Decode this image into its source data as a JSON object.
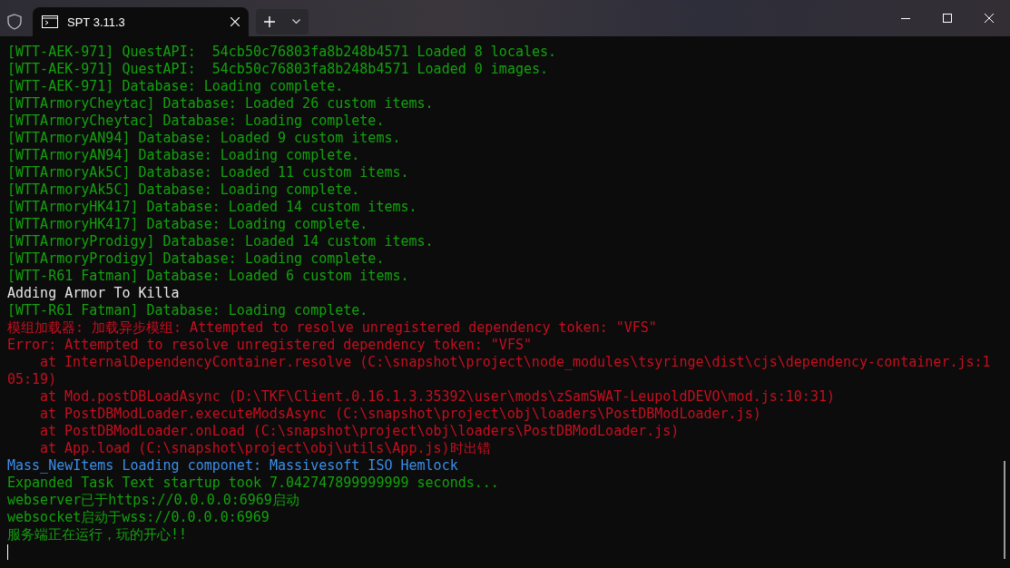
{
  "window": {
    "tab_title": "SPT 3.11.3"
  },
  "terminal": {
    "lines": [
      {
        "text": "[WTT-AEK-971] QuestAPI:  54cb50c76803fa8b248b4571 Loaded 8 locales.",
        "color": "#13a10e",
        "indented": false
      },
      {
        "text": "[WTT-AEK-971] QuestAPI:  54cb50c76803fa8b248b4571 Loaded 0 images.",
        "color": "#13a10e",
        "indented": false
      },
      {
        "text": "[WTT-AEK-971] Database: Loading complete.",
        "color": "#13a10e",
        "indented": false
      },
      {
        "text": "[WTTArmoryCheytac] Database: Loaded 26 custom items.",
        "color": "#13a10e",
        "indented": false
      },
      {
        "text": "[WTTArmoryCheytac] Database: Loading complete.",
        "color": "#13a10e",
        "indented": false
      },
      {
        "text": "[WTTArmoryAN94] Database: Loaded 9 custom items.",
        "color": "#13a10e",
        "indented": false
      },
      {
        "text": "[WTTArmoryAN94] Database: Loading complete.",
        "color": "#13a10e",
        "indented": false
      },
      {
        "text": "[WTTArmoryAk5C] Database: Loaded 11 custom items.",
        "color": "#13a10e",
        "indented": false
      },
      {
        "text": "[WTTArmoryAk5C] Database: Loading complete.",
        "color": "#13a10e",
        "indented": false
      },
      {
        "text": "[WTTArmoryHK417] Database: Loaded 14 custom items.",
        "color": "#13a10e",
        "indented": false
      },
      {
        "text": "[WTTArmoryHK417] Database: Loading complete.",
        "color": "#13a10e",
        "indented": false
      },
      {
        "text": "[WTTArmoryProdigy] Database: Loaded 14 custom items.",
        "color": "#13a10e",
        "indented": false
      },
      {
        "text": "[WTTArmoryProdigy] Database: Loading complete.",
        "color": "#13a10e",
        "indented": false
      },
      {
        "text": "[WTT-R61 Fatman] Database: Loaded 6 custom items.",
        "color": "#13a10e",
        "indented": false
      },
      {
        "text": "Adding Armor To Killa",
        "color": "#e6e6e6",
        "indented": false
      },
      {
        "text": "[WTT-R61 Fatman] Database: Loading complete.",
        "color": "#13a10e",
        "indented": false
      },
      {
        "text": "模组加载器: 加载异步模组: Attempted to resolve unregistered dependency token: \"VFS\"",
        "color": "#c50f1f",
        "indented": false
      },
      {
        "text": "Error: Attempted to resolve unregistered dependency token: \"VFS\"",
        "color": "#c50f1f",
        "indented": false
      },
      {
        "text": "at InternalDependencyContainer.resolve (C:\\snapshot\\project\\node_modules\\tsyringe\\dist\\cjs\\dependency-container.js:1",
        "color": "#c50f1f",
        "indented": true
      },
      {
        "text": "05:19)",
        "color": "#c50f1f",
        "indented": false
      },
      {
        "text": "at Mod.postDBLoadAsync (D:\\TKF\\Client.0.16.1.3.35392\\user\\mods\\zSamSWAT-LeupoldDEVO\\mod.js:10:31)",
        "color": "#c50f1f",
        "indented": true
      },
      {
        "text": "at PostDBModLoader.executeModsAsync (C:\\snapshot\\project\\obj\\loaders\\PostDBModLoader.js)",
        "color": "#c50f1f",
        "indented": true
      },
      {
        "text": "at PostDBModLoader.onLoad (C:\\snapshot\\project\\obj\\loaders\\PostDBModLoader.js)",
        "color": "#c50f1f",
        "indented": true
      },
      {
        "text": "at App.load (C:\\snapshot\\project\\obj\\utils\\App.js)时出错",
        "color": "#c50f1f",
        "indented": true
      },
      {
        "text": "Mass_NewItems Loading componet: Massivesoft ISO Hemlock",
        "color": "#3b8eea",
        "indented": false
      },
      {
        "text": "Expanded Task Text startup took 7.042747899999999 seconds...",
        "color": "#13a10e",
        "indented": false
      },
      {
        "text": "webserver已于https://0.0.0.0:6969启动",
        "color": "#13a10e",
        "indented": false
      },
      {
        "text": "websocket启动于wss://0.0.0.0:6969",
        "color": "#13a10e",
        "indented": false
      },
      {
        "text": "服务端正在运行，玩的开心!!",
        "color": "#13a10e",
        "indented": false
      }
    ]
  }
}
